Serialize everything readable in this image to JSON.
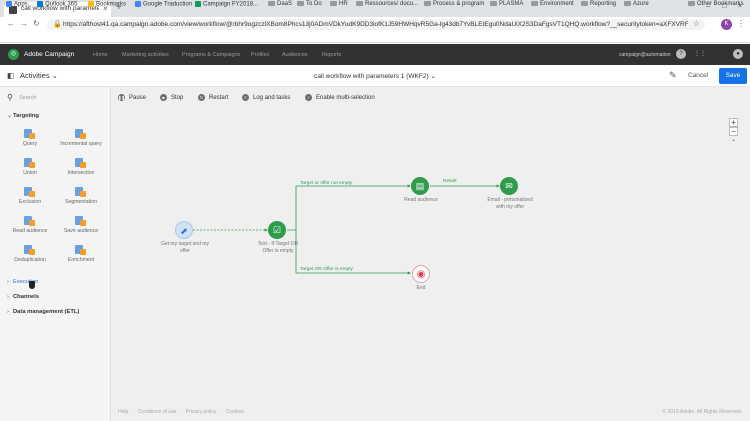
{
  "browser": {
    "tab_title": "call workflow with parameters",
    "url": "https://afthost41.qa.campaign.adobe.com/view/workflow/@rbhr9ogzczlXBom8Phcs13j0ADmVDkYudK9DD3iofK1J59HWHqvR5Ga-lg43db7YvBLEtEgu0NdaUiX2S3DaFgsVT1QHQ.workflow?__securitytoken=aXFXVRFyl...",
    "profile_initial": "K",
    "bookmarks": [
      {
        "label": "Apps",
        "icon": "apps-icon"
      },
      {
        "label": "Outlook 365",
        "icon": "outlook-icon"
      },
      {
        "label": "Bookmarks",
        "icon": "star-icon"
      },
      {
        "label": "Google Traduction",
        "icon": "translate-icon"
      },
      {
        "label": "Campaign FY2018...",
        "icon": "sheet-icon"
      },
      {
        "label": "DaaS",
        "icon": "folder-icon"
      },
      {
        "label": "To Do",
        "icon": "folder-icon"
      },
      {
        "label": "HR",
        "icon": "folder-icon"
      },
      {
        "label": "Ressources/ docu...",
        "icon": "folder-icon"
      },
      {
        "label": "Process & program",
        "icon": "folder-icon"
      },
      {
        "label": "PLASMA",
        "icon": "folder-icon"
      },
      {
        "label": "Environment",
        "icon": "folder-icon"
      },
      {
        "label": "Reporting",
        "icon": "folder-icon"
      },
      {
        "label": "Azure",
        "icon": "folder-icon"
      },
      {
        "label": "Other Bookmarks",
        "icon": "folder-icon"
      }
    ]
  },
  "app": {
    "name": "Adobe Campaign",
    "nav": [
      "Home",
      "Marketing activities",
      "Programs & Campaigns",
      "Profiles",
      "Audiences",
      "Reports"
    ],
    "user": "campaign@automation"
  },
  "subheader": {
    "activities": "Activities",
    "workflow_title": "call workflow with parameters 1 (WKF2)",
    "cancel": "Cancel",
    "save": "Save"
  },
  "sidebar": {
    "search": "Search",
    "targeting": "Targeting",
    "activities": [
      {
        "label": "Query"
      },
      {
        "label": "Incremental query"
      },
      {
        "label": "Union"
      },
      {
        "label": "Intersection"
      },
      {
        "label": "Exclusion"
      },
      {
        "label": "Segmentation"
      },
      {
        "label": "Read audience"
      },
      {
        "label": "Save audience"
      },
      {
        "label": "Deduplication"
      },
      {
        "label": "Enrichment"
      }
    ],
    "execution": "Execution",
    "channels": "Channels",
    "data_management": "Data management (ETL)"
  },
  "toolbar": {
    "pause": "Pause",
    "stop": "Stop",
    "restart": "Restart",
    "log": "Log and tasks",
    "multi": "Enable multi-selection",
    "zoom_in": "+",
    "zoom_out": "−"
  },
  "flow": {
    "start_label": "Get my target and my offer",
    "test_label": "Test - If Target OR Offer is empty",
    "read_label": "Read audience",
    "email_label": "Email - personalized with my offer",
    "end_label": "End",
    "edge_top": "Target or offer not empty",
    "edge_bottom": "Target OR Offer is empty",
    "edge_right": "Result"
  },
  "footer": {
    "help": "Help",
    "terms": "Conditions of use",
    "privacy": "Privacy policy",
    "cookies": "Cookies",
    "copyright": "© 2019 Adobe. All Rights Reserved."
  },
  "colors": {
    "green": "#2d9d4b",
    "blue_save": "#1473e6",
    "start_node": "#cfe3f5",
    "end_node": "#e03a4e"
  }
}
